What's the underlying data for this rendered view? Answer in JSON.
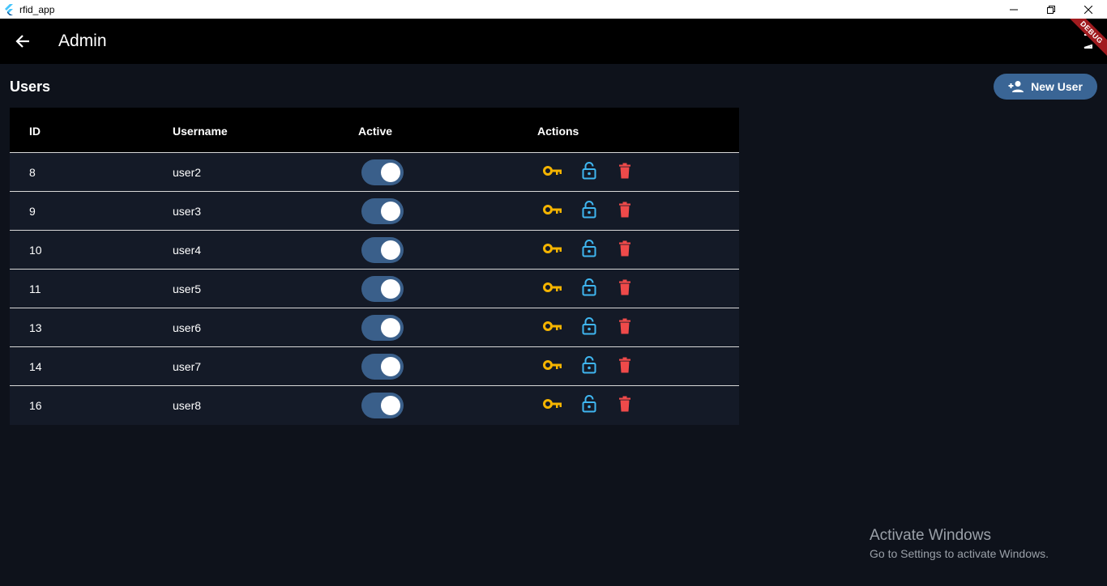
{
  "window": {
    "title": "rfid_app"
  },
  "appbar": {
    "title": "Admin",
    "debug_banner": "DEBUG"
  },
  "section": {
    "title": "Users"
  },
  "new_user_button": {
    "label": "New User"
  },
  "table": {
    "headers": {
      "id": "ID",
      "username": "Username",
      "active": "Active",
      "actions": "Actions"
    },
    "rows": [
      {
        "id": "8",
        "username": "user2",
        "active": true
      },
      {
        "id": "9",
        "username": "user3",
        "active": true
      },
      {
        "id": "10",
        "username": "user4",
        "active": true
      },
      {
        "id": "11",
        "username": "user5",
        "active": true
      },
      {
        "id": "13",
        "username": "user6",
        "active": true
      },
      {
        "id": "14",
        "username": "user7",
        "active": true
      },
      {
        "id": "16",
        "username": "user8",
        "active": true
      }
    ]
  },
  "icons": {
    "key": "key-icon",
    "lock": "lock-open-icon",
    "delete": "delete-icon",
    "back": "arrow-back-icon",
    "add_user": "person-add-icon"
  },
  "colors": {
    "key": "#f5b400",
    "lock": "#3fb6f0",
    "delete": "#ef4a4a",
    "switch_track": "#3a5f8a",
    "button": "#3a6595"
  },
  "watermark": {
    "line1": "Activate Windows",
    "line2": "Go to Settings to activate Windows."
  }
}
